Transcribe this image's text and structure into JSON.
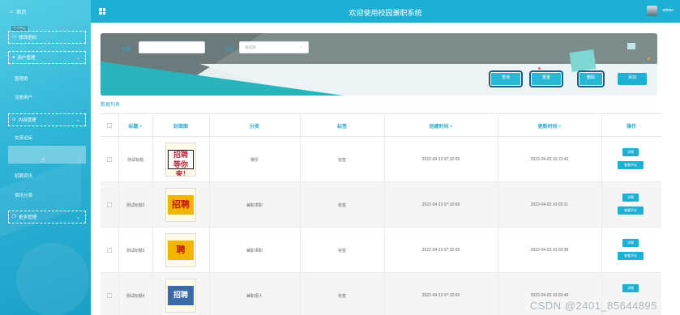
{
  "sidebar": {
    "home_label": "首页",
    "tag_label": "个人中心",
    "items": [
      {
        "label": "修改密码",
        "type": "header"
      },
      {
        "label": "用户管理",
        "type": "group"
      },
      {
        "label": "管理员",
        "type": "sub"
      },
      {
        "label": "注册用户",
        "type": "sub"
      },
      {
        "label": "内容管理",
        "type": "group"
      },
      {
        "label": "交流论坛",
        "type": "sub"
      },
      {
        "label": "招聘资讯",
        "type": "sub"
      },
      {
        "label": "资讯分类",
        "type": "sub"
      },
      {
        "label": "更多管理",
        "type": "group"
      }
    ]
  },
  "header": {
    "title": "欢迎使用校园兼职系统",
    "user": "admin"
  },
  "search": {
    "title_label": "标题",
    "category_label": "分类",
    "category_placeholder": "请选择",
    "btn_search": "查询",
    "btn_reset": "重置",
    "btn_delete": "删除",
    "btn_add": "添加"
  },
  "list_title": "数据列表",
  "table": {
    "headers": [
      "标题 ÷",
      "封面图",
      "分类",
      "标签",
      "创建时间 ÷",
      "更新时间 ÷",
      "操作"
    ],
    "rows": [
      {
        "title": "测试标题",
        "cover": "招聘 等你来!",
        "category": "娱乐",
        "tag": "标签",
        "created": "2022-04-19 07:32:09",
        "updated": "2022-04-03 10:13:42"
      },
      {
        "title": "测试标题2",
        "cover": "招聘",
        "category": "兼职求职",
        "tag": "标签",
        "created": "2022-04-19 07:32:09",
        "updated": "2022-04-03 10:03:31"
      },
      {
        "title": "测试标题3",
        "cover": "聘",
        "category": "兼职求职",
        "tag": "标签",
        "created": "2022-04-19 07:32:09",
        "updated": "2022-04-03 10:03:38"
      },
      {
        "title": "测试标题4",
        "cover": "招聘",
        "category": "兼职招人",
        "tag": "标签",
        "created": "2022-04-19 07:32:09",
        "updated": "2022-04-03 10:03:49"
      }
    ],
    "op_detail": "详情",
    "op_comment": "查看评论"
  },
  "watermark": "CSDN @2401_85644895"
}
